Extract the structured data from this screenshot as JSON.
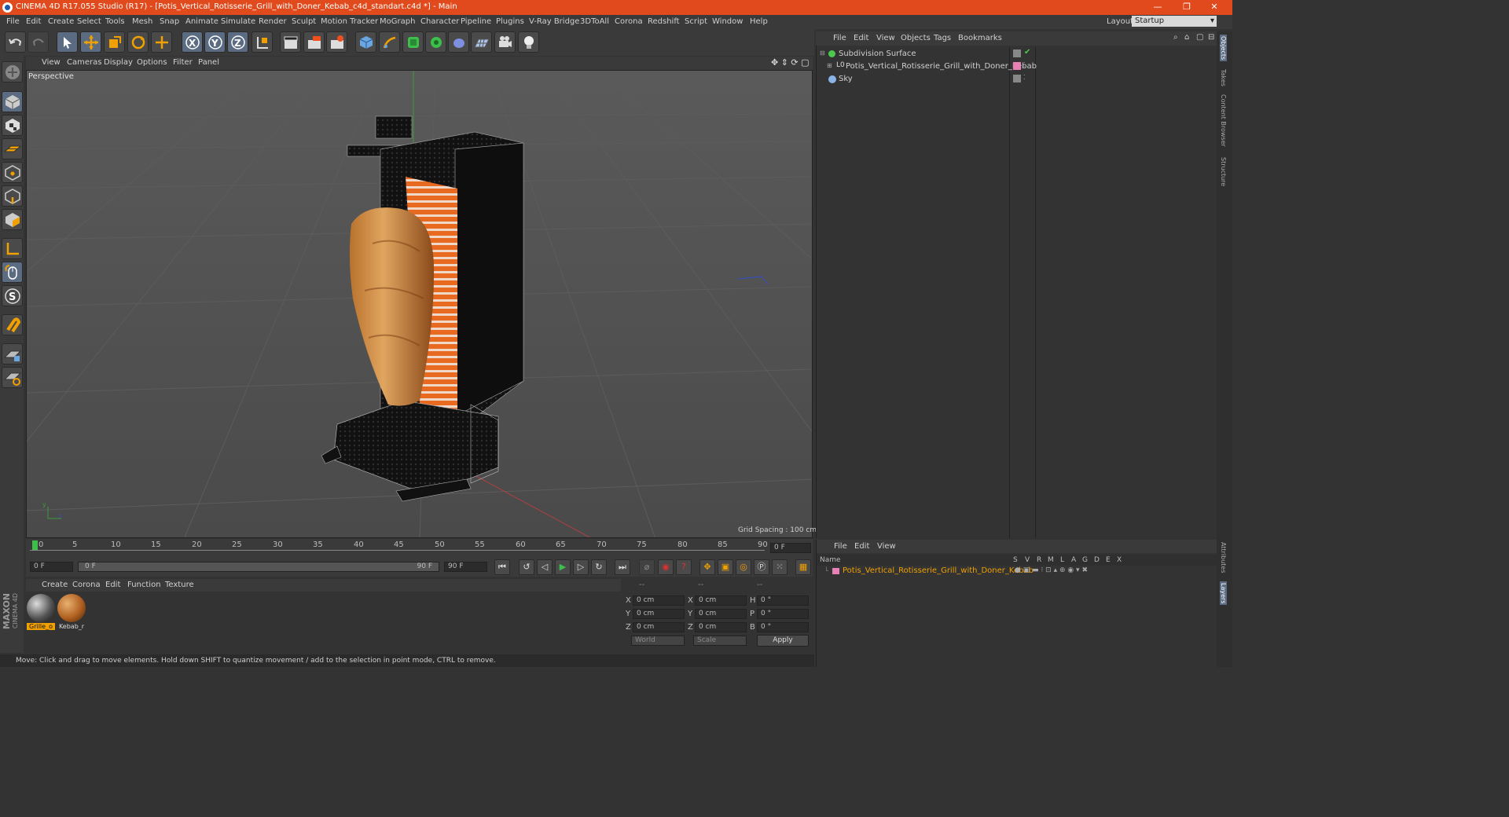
{
  "window": {
    "title": "CINEMA 4D R17.055 Studio (R17) - [Potis_Vertical_Rotisserie_Grill_with_Doner_Kebab_c4d_standart.c4d *] - Main",
    "minimize": "—",
    "restore": "❐",
    "close": "✕"
  },
  "menubar": {
    "items": [
      "File",
      "Edit",
      "Create",
      "Select",
      "Tools",
      "Mesh",
      "Snap",
      "Animate",
      "Simulate",
      "Render",
      "Sculpt",
      "Motion Tracker",
      "MoGraph",
      "Character",
      "Pipeline",
      "Plugins",
      "V-Ray Bridge",
      "3DToAll",
      "Corona",
      "Redshift",
      "Script",
      "Window",
      "Help"
    ],
    "layout_label": "Layout:",
    "layout_value": "Startup"
  },
  "viewport": {
    "menu": [
      "View",
      "Cameras",
      "Display",
      "Options",
      "Filter",
      "Panel"
    ],
    "label": "Perspective",
    "grid_spacing": "Grid Spacing : 100 cm",
    "axis_y": "y",
    "axis_z": "z"
  },
  "timeline": {
    "ticks": [
      "0",
      "5",
      "10",
      "15",
      "20",
      "25",
      "30",
      "35",
      "40",
      "45",
      "50",
      "55",
      "60",
      "65",
      "70",
      "75",
      "80",
      "85",
      "90"
    ],
    "current_frame": "0 F",
    "start_field": "0 F",
    "slider_start": "0 F",
    "slider_end": "90 F",
    "end_field": "90 F"
  },
  "materials": {
    "menu": [
      "Create",
      "Corona",
      "Edit",
      "Function",
      "Texture"
    ],
    "items": [
      {
        "name": "Grille_o",
        "selected": true
      },
      {
        "name": "Kebab_r",
        "selected": false
      }
    ],
    "brand_top": "MAXON",
    "brand_bottom": "CINEMA 4D"
  },
  "coordinates": {
    "headers": [
      "--",
      "--",
      "--"
    ],
    "rows": [
      {
        "a": "X",
        "av": "0 cm",
        "b": "X",
        "bv": "0 cm",
        "c": "H",
        "cv": "0 °"
      },
      {
        "a": "Y",
        "av": "0 cm",
        "b": "Y",
        "bv": "0 cm",
        "c": "P",
        "cv": "0 °"
      },
      {
        "a": "Z",
        "av": "0 cm",
        "b": "Z",
        "bv": "0 cm",
        "c": "B",
        "cv": "0 °"
      }
    ],
    "space": "World",
    "mode": "Scale",
    "apply": "Apply"
  },
  "status": "Move: Click and drag to move elements. Hold down SHIFT to quantize movement / add to the selection in point mode, CTRL to remove.",
  "objects": {
    "menu": [
      "File",
      "Edit",
      "View",
      "Objects",
      "Tags",
      "Bookmarks"
    ],
    "items": [
      {
        "name": "Subdivision Surface",
        "color": "#4ec94e"
      },
      {
        "name": "Potis_Vertical_Rotisserie_Grill_with_Doner_Kebab",
        "color": "#e87fb5"
      },
      {
        "name": "Sky",
        "color": "#8ab4e8"
      }
    ]
  },
  "layers": {
    "menu": [
      "File",
      "Edit",
      "View"
    ],
    "name_header": "Name",
    "col_headers": [
      "S",
      "V",
      "R",
      "M",
      "L",
      "A",
      "G",
      "D",
      "E",
      "X"
    ],
    "layer_name": "Potis_Vertical_Rotisserie_Grill_with_Doner_Kebab",
    "layer_color": "#e87fb5"
  },
  "right_tabs": [
    "Objects",
    "Takes",
    "Content Browser",
    "Structure",
    "Attributes",
    "Layers"
  ],
  "colors": {
    "title": "#e04a1c",
    "accent": "#f0a000",
    "selected_blue": "#5a6b82"
  }
}
